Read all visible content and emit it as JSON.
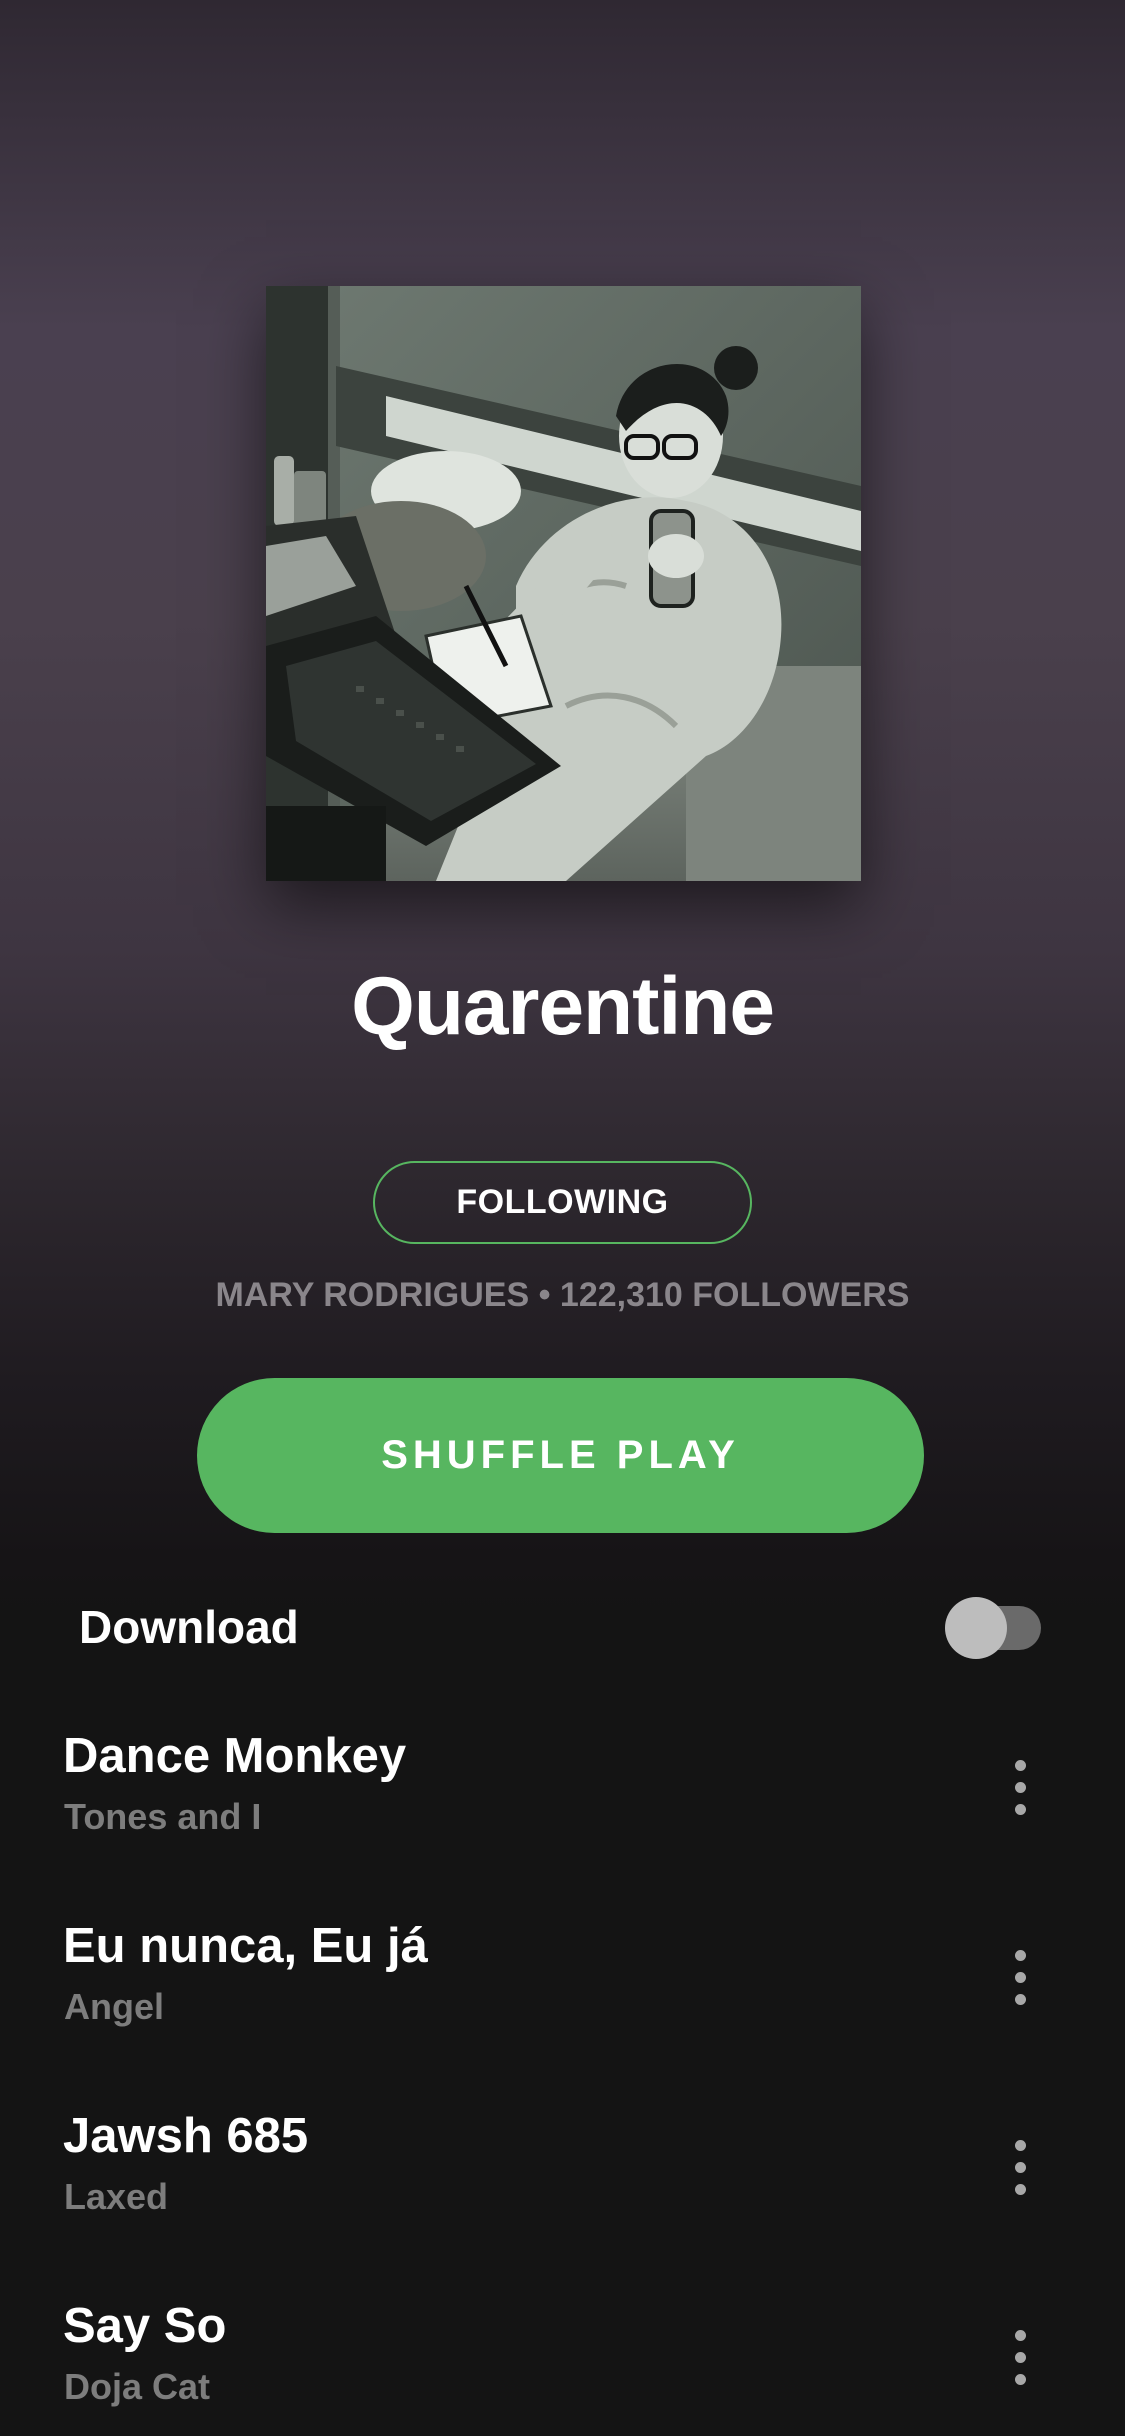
{
  "playlist": {
    "title": "Quarentine",
    "cover_image": "black-and-white photo of a woman in pajamas writing in a notebook on a bed with a laptop",
    "follow_label": "FOLLOWING",
    "owner_line": "MARY RODRIGUES • 122,310 FOLLOWERS"
  },
  "actions": {
    "shuffle_label": "SHUFFLE PLAY",
    "download_label": "Download",
    "download_enabled": false
  },
  "tracks": [
    {
      "title": "Dance Monkey",
      "artist": "Tones and I"
    },
    {
      "title": "Eu nunca, Eu já",
      "artist": "Angel"
    },
    {
      "title": "Jawsh 685",
      "artist": "Laxed"
    },
    {
      "title": "Say So",
      "artist": "Doja Cat"
    }
  ],
  "colors": {
    "accent_green": "#57b660",
    "background": "#141414",
    "secondary_text": "#7d7d7d"
  },
  "icons": {
    "more": "more-vertical-icon"
  }
}
